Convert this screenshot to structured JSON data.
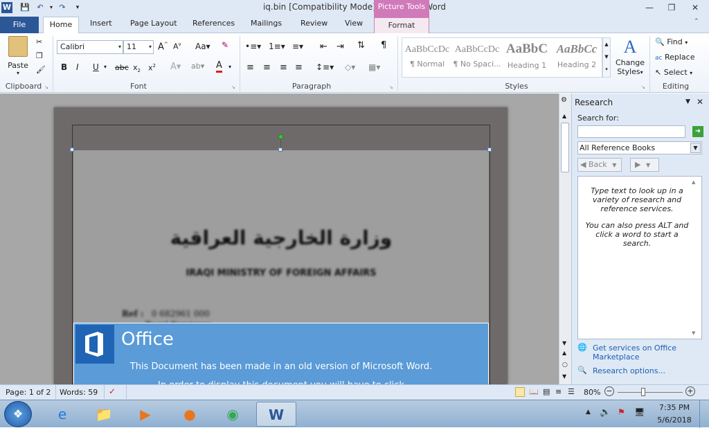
{
  "window": {
    "title": "iq.bin [Compatibility Mode]  -  Microsoft Word",
    "contextual_tab_group": "Picture Tools",
    "contextual_tab": "Format"
  },
  "tabs": [
    "File",
    "Home",
    "Insert",
    "Page Layout",
    "References",
    "Mailings",
    "Review",
    "View"
  ],
  "ribbon": {
    "clipboard": {
      "paste_label": "Paste",
      "group_label": "Clipboard"
    },
    "font": {
      "font_name": "Calibri",
      "font_size": "11",
      "group_label": "Font"
    },
    "paragraph": {
      "group_label": "Paragraph"
    },
    "styles": {
      "group_label": "Styles",
      "tiles": [
        {
          "preview": "AaBbCcDc",
          "label": "¶ Normal"
        },
        {
          "preview": "AaBbCcDc",
          "label": "¶ No Spaci..."
        },
        {
          "preview": "AaBbC",
          "label": "Heading 1"
        },
        {
          "preview": "AaBbCc",
          "label": "Heading 2"
        }
      ],
      "change_styles_label_1": "Change",
      "change_styles_label_2": "Styles"
    },
    "editing": {
      "find": "Find",
      "replace": "Replace",
      "select": "Select",
      "group_label": "Editing"
    }
  },
  "document": {
    "arabic_title": "وزارة الخارجية العراقية",
    "english_title": "IRAQI MINISTRY OF FOREIGN AFFAIRS",
    "ref_label": "Ref :",
    "ref_line1": "0 682961 000",
    "ref_line2": "Toepl Komisyou",
    "office_word": "Office",
    "office_message": "This Document has been made in an old version of Microsoft Word.",
    "office_message_2": "In order to display this document you will have to click"
  },
  "research": {
    "title": "Research",
    "search_for_label": "Search for:",
    "search_value": "",
    "reference_dropdown": "All Reference Books",
    "back_label": "Back",
    "help_text_1": "Type text to look up in a variety of research and reference services.",
    "help_text_2": "You can also press ALT and click a word to start a search.",
    "link_services": "Get services on Office Marketplace",
    "link_options": "Research options..."
  },
  "statusbar": {
    "page": "Page: 1 of 2",
    "words": "Words: 59",
    "zoom": "80%"
  },
  "taskbar": {
    "time": "7:35 PM",
    "date": "5/6/2018"
  },
  "colors": {
    "office_blue": "#5a9bd8",
    "file_tab": "#2b5797",
    "picture_tools": "#d07ab9"
  }
}
